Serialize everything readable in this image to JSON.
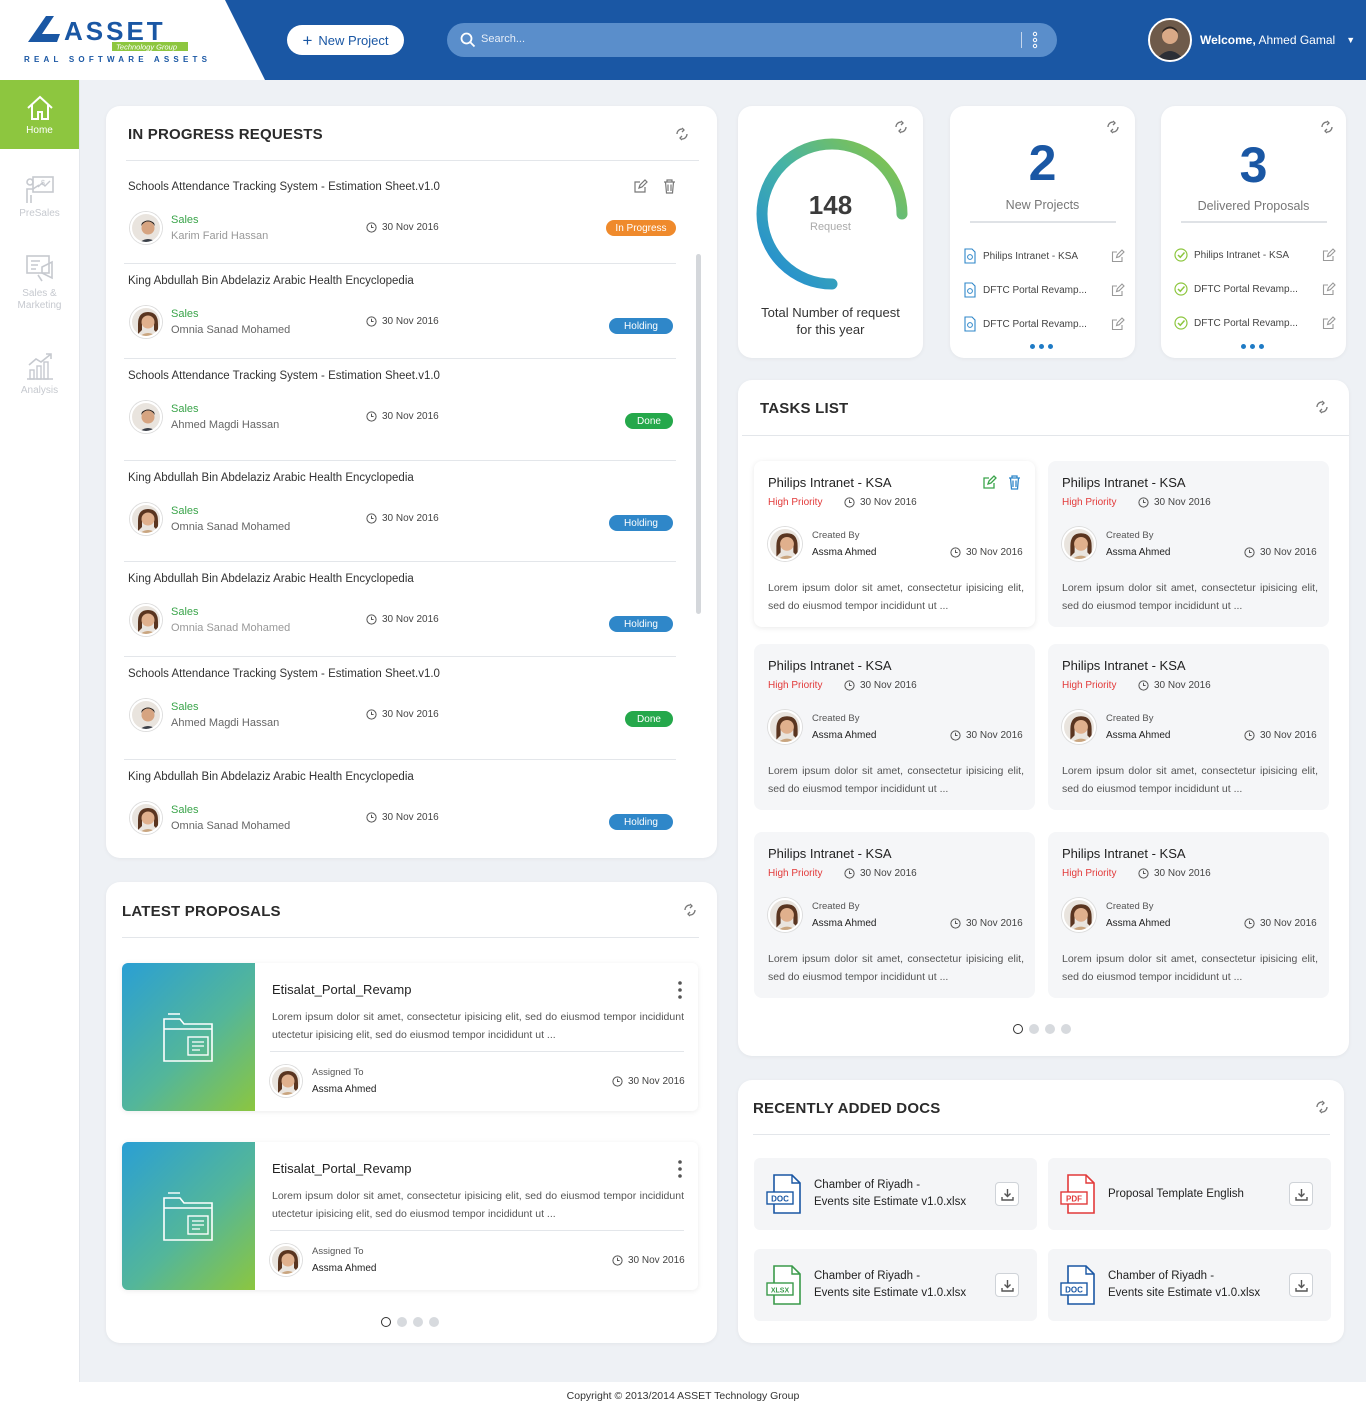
{
  "header": {
    "logo_text": "ASSET",
    "logo_badge": "Technology Group",
    "logo_tagline": "REAL SOFTWARE ASSETS",
    "new_project_label": "New Project",
    "search_placeholder": "Search...",
    "welcome_prefix": "Welcome,",
    "user_name": "Ahmed Gamal"
  },
  "sidebar": {
    "items": [
      {
        "label": "Home",
        "icon": "home-icon"
      },
      {
        "label": "PreSales",
        "icon": "presentation-icon"
      },
      {
        "label": "Sales & Marketing",
        "icon": "marketing-icon"
      },
      {
        "label": "Analysis",
        "icon": "analysis-chart-icon"
      }
    ]
  },
  "in_progress": {
    "title": "IN PROGRESS REQUESTS",
    "requests": [
      {
        "title": "Schools Attendance Tracking System - Estimation Sheet.v1.0",
        "category": "Sales",
        "person": "Karim Farid Hassan",
        "date": "30 Nov 2016",
        "status": "In Progress"
      },
      {
        "title": "King Abdullah Bin Abdelaziz Arabic Health Encyclopedia",
        "category": "Sales",
        "person": "Omnia Sanad Mohamed",
        "date": "30 Nov 2016",
        "status": "Holding"
      },
      {
        "title": "Schools Attendance Tracking System - Estimation Sheet.v1.0",
        "category": "Sales",
        "person": "Ahmed Magdi Hassan",
        "date": "30 Nov 2016",
        "status": "Done"
      },
      {
        "title": "King Abdullah Bin Abdelaziz Arabic Health Encyclopedia",
        "category": "Sales",
        "person": "Omnia Sanad Mohamed",
        "date": "30 Nov 2016",
        "status": "Holding"
      },
      {
        "title": "King Abdullah Bin Abdelaziz Arabic Health Encyclopedia",
        "category": "Sales",
        "person": "Omnia Sanad Mohamed",
        "date": "30 Nov 2016",
        "status": "Holding"
      },
      {
        "title": "Schools Attendance Tracking System - Estimation Sheet.v1.0",
        "category": "Sales",
        "person": "Ahmed Magdi Hassan",
        "date": "30 Nov 2016",
        "status": "Done"
      },
      {
        "title": "King Abdullah Bin Abdelaziz Arabic Health Encyclopedia",
        "category": "Sales",
        "person": "Omnia Sanad Mohamed",
        "date": "30 Nov 2016",
        "status": "Holding"
      }
    ]
  },
  "total_requests": {
    "value": "148",
    "unit": "Request",
    "caption_line1": "Total Number  of request",
    "caption_line2": "for this year",
    "gauge_fraction": 0.75
  },
  "new_projects": {
    "value": "2",
    "label": "New Projects",
    "items": [
      "Philips Intranet - KSA",
      "DFTC Portal Revamp...",
      "DFTC Portal Revamp..."
    ]
  },
  "delivered": {
    "value": "3",
    "label": "Delivered Proposals",
    "items": [
      "Philips Intranet - KSA",
      "DFTC Portal Revamp...",
      "DFTC Portal Revamp..."
    ]
  },
  "tasks": {
    "title": "TASKS LIST",
    "items": [
      {
        "title": "Philips Intranet - KSA",
        "priority": "High Priority",
        "date": "30 Nov 2016",
        "created_by_label": "Created By",
        "creator": "Assma Ahmed",
        "created_date": "30 Nov 2016",
        "desc": "Lorem ipsum dolor sit amet, consectetur ipisicing elit, sed do eiusmod tempor incididunt ut ..."
      },
      {
        "title": "Philips Intranet - KSA",
        "priority": "High Priority",
        "date": "30 Nov 2016",
        "created_by_label": "Created By",
        "creator": "Assma Ahmed",
        "created_date": "30 Nov 2016",
        "desc": "Lorem ipsum dolor sit amet, consectetur ipisicing elit, sed do eiusmod tempor incididunt ut ..."
      },
      {
        "title": "Philips Intranet - KSA",
        "priority": "High Priority",
        "date": "30 Nov 2016",
        "created_by_label": "Created By",
        "creator": "Assma Ahmed",
        "created_date": "30 Nov 2016",
        "desc": "Lorem ipsum dolor sit amet, consectetur ipisicing elit, sed do eiusmod tempor incididunt ut ..."
      },
      {
        "title": "Philips Intranet - KSA",
        "priority": "High Priority",
        "date": "30 Nov 2016",
        "created_by_label": "Created By",
        "creator": "Assma Ahmed",
        "created_date": "30 Nov 2016",
        "desc": "Lorem ipsum dolor sit amet, consectetur ipisicing elit, sed do eiusmod tempor incididunt ut ..."
      },
      {
        "title": "Philips Intranet - KSA",
        "priority": "High Priority",
        "date": "30 Nov 2016",
        "created_by_label": "Created By",
        "creator": "Assma Ahmed",
        "created_date": "30 Nov 2016",
        "desc": "Lorem ipsum dolor sit amet, consectetur ipisicing elit, sed do eiusmod tempor incididunt ut ..."
      },
      {
        "title": "Philips Intranet - KSA",
        "priority": "High Priority",
        "date": "30 Nov 2016",
        "created_by_label": "Created By",
        "creator": "Assma Ahmed",
        "created_date": "30 Nov 2016",
        "desc": "Lorem ipsum dolor sit amet, consectetur ipisicing elit, sed do eiusmod tempor incididunt ut ..."
      }
    ]
  },
  "proposals": {
    "title": "LATEST PROPOSALS",
    "items": [
      {
        "title": "Etisalat_Portal_Revamp",
        "desc": "Lorem ipsum dolor sit amet, consectetur ipisicing elit, sed do eiusmod tempor incididunt utectetur ipisicing elit, sed do eiusmod tempor incididunt ut ...",
        "assigned_label": "Assigned To",
        "assignee": "Assma Ahmed",
        "date": "30 Nov 2016"
      },
      {
        "title": "Etisalat_Portal_Revamp",
        "desc": "Lorem ipsum dolor sit amet, consectetur ipisicing elit, sed do eiusmod tempor incididunt utectetur ipisicing elit, sed do eiusmod tempor incididunt ut ...",
        "assigned_label": "Assigned To",
        "assignee": "Assma Ahmed",
        "date": "30 Nov 2016"
      }
    ]
  },
  "docs": {
    "title": "RECENTLY ADDED DOCS",
    "items": [
      {
        "type": "DOC",
        "line1": "Chamber of Riyadh -",
        "line2": "Events site Estimate v1.0.xlsx"
      },
      {
        "type": "PDF",
        "line1": "Proposal Template English",
        "line2": ""
      },
      {
        "type": "XLSX",
        "line1": "Chamber of Riyadh -",
        "line2": "Events site Estimate v1.0.xlsx"
      },
      {
        "type": "DOC",
        "line1": "Chamber of Riyadh -",
        "line2": "Events site Estimate v1.0.xlsx"
      }
    ]
  },
  "footer": {
    "copyright": "Copyright © 2013/2014 ASSET Technology Group"
  },
  "colors": {
    "brand_blue": "#1a57a4",
    "accent_green": "#8dc63f",
    "in_progress": "#ef8a2c",
    "holding": "#2f87c9",
    "done": "#25a84b",
    "priority_red": "#e23a3a"
  }
}
